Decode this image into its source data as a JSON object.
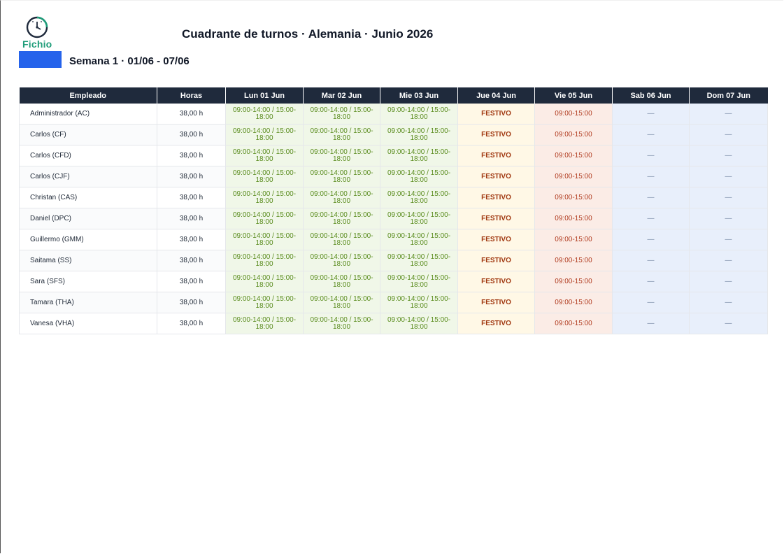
{
  "logo": {
    "text": "Fichio",
    "icon": "clock-icon",
    "color": "#1f9d7a"
  },
  "title": "Cuadrante de turnos · Alemania · Junio 2026",
  "week": {
    "label": "Semana 1 · 01/06 - 07/06",
    "accent": "#2563eb"
  },
  "table": {
    "headers": [
      "Empleado",
      "Horas",
      "Lun 01 Jun",
      "Mar 02 Jun",
      "Mie 03 Jun",
      "Jue 04 Jun",
      "Vie 05 Jun",
      "Sab 06 Jun",
      "Dom 07 Jun"
    ],
    "rows": [
      {
        "employee": "Administrador (AC)",
        "hours": "38,00 h",
        "days": [
          "09:00-14:00 / 15:00-18:00",
          "09:00-14:00 / 15:00-18:00",
          "09:00-14:00 / 15:00-18:00",
          "FESTIVO",
          "09:00-15:00",
          "—",
          "—"
        ]
      },
      {
        "employee": "Carlos (CF)",
        "hours": "38,00 h",
        "days": [
          "09:00-14:00 / 15:00-18:00",
          "09:00-14:00 / 15:00-18:00",
          "09:00-14:00 / 15:00-18:00",
          "FESTIVO",
          "09:00-15:00",
          "—",
          "—"
        ]
      },
      {
        "employee": "Carlos (CFD)",
        "hours": "38,00 h",
        "days": [
          "09:00-14:00 / 15:00-18:00",
          "09:00-14:00 / 15:00-18:00",
          "09:00-14:00 / 15:00-18:00",
          "FESTIVO",
          "09:00-15:00",
          "—",
          "—"
        ]
      },
      {
        "employee": "Carlos (CJF)",
        "hours": "38,00 h",
        "days": [
          "09:00-14:00 / 15:00-18:00",
          "09:00-14:00 / 15:00-18:00",
          "09:00-14:00 / 15:00-18:00",
          "FESTIVO",
          "09:00-15:00",
          "—",
          "—"
        ]
      },
      {
        "employee": "Christan (CAS)",
        "hours": "38,00 h",
        "days": [
          "09:00-14:00 / 15:00-18:00",
          "09:00-14:00 / 15:00-18:00",
          "09:00-14:00 / 15:00-18:00",
          "FESTIVO",
          "09:00-15:00",
          "—",
          "—"
        ]
      },
      {
        "employee": "Daniel (DPC)",
        "hours": "38,00 h",
        "days": [
          "09:00-14:00 / 15:00-18:00",
          "09:00-14:00 / 15:00-18:00",
          "09:00-14:00 / 15:00-18:00",
          "FESTIVO",
          "09:00-15:00",
          "—",
          "—"
        ]
      },
      {
        "employee": "Guillermo (GMM)",
        "hours": "38,00 h",
        "days": [
          "09:00-14:00 / 15:00-18:00",
          "09:00-14:00 / 15:00-18:00",
          "09:00-14:00 / 15:00-18:00",
          "FESTIVO",
          "09:00-15:00",
          "—",
          "—"
        ]
      },
      {
        "employee": "Saitama (SS)",
        "hours": "38,00 h",
        "days": [
          "09:00-14:00 / 15:00-18:00",
          "09:00-14:00 / 15:00-18:00",
          "09:00-14:00 / 15:00-18:00",
          "FESTIVO",
          "09:00-15:00",
          "—",
          "—"
        ]
      },
      {
        "employee": "Sara (SFS)",
        "hours": "38,00 h",
        "days": [
          "09:00-14:00 / 15:00-18:00",
          "09:00-14:00 / 15:00-18:00",
          "09:00-14:00 / 15:00-18:00",
          "FESTIVO",
          "09:00-15:00",
          "—",
          "—"
        ]
      },
      {
        "employee": "Tamara (THA)",
        "hours": "38,00 h",
        "days": [
          "09:00-14:00 / 15:00-18:00",
          "09:00-14:00 / 15:00-18:00",
          "09:00-14:00 / 15:00-18:00",
          "FESTIVO",
          "09:00-15:00",
          "—",
          "—"
        ]
      },
      {
        "employee": "Vanesa (VHA)",
        "hours": "38,00 h",
        "days": [
          "09:00-14:00 / 15:00-18:00",
          "09:00-14:00 / 15:00-18:00",
          "09:00-14:00 / 15:00-18:00",
          "FESTIVO",
          "09:00-15:00",
          "—",
          "—"
        ]
      }
    ],
    "colors": {
      "header_bg": "#1f2a3c",
      "work_bg": "#f0f7e8",
      "work_text": "#5a8c1e",
      "holiday_bg": "#fff8e6",
      "holiday_text": "#a0370f",
      "partial_bg": "#fbece6",
      "partial_text": "#b03a1e",
      "off_bg": "#e8effb"
    }
  }
}
